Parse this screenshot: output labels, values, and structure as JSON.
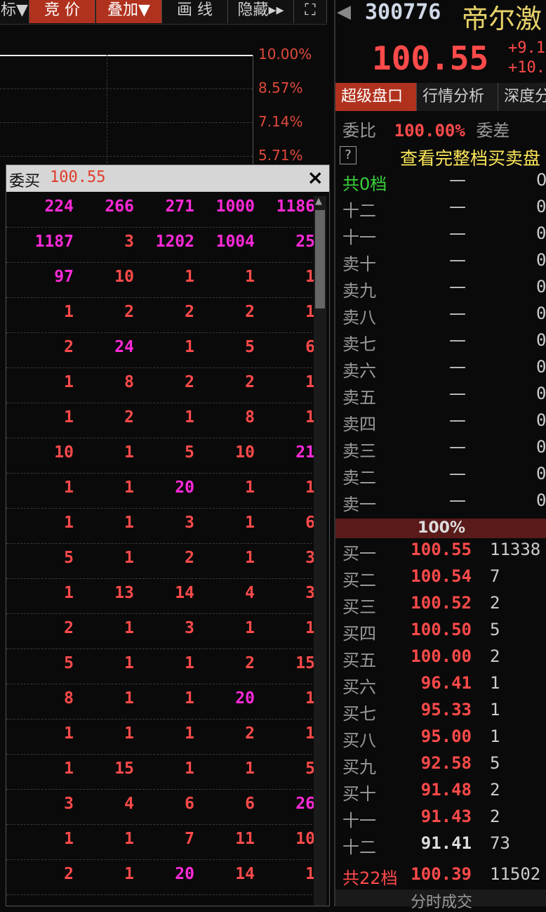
{
  "toolbar": {
    "items": [
      "标▼",
      "竞 价",
      "叠加▼",
      "画 线",
      "隐藏▸▸",
      "⛶"
    ]
  },
  "chart": {
    "pct_labels": [
      "10.00%",
      "8.57%",
      "7.14%",
      "5.71%"
    ]
  },
  "popup": {
    "title": "委买",
    "price": "100.55",
    "close": "×",
    "rows": [
      [
        [
          "224",
          "m"
        ],
        [
          "266",
          "m"
        ],
        [
          "271",
          "m"
        ],
        [
          "1000",
          "m"
        ],
        [
          "1186",
          "m"
        ]
      ],
      [
        [
          "1187",
          "m"
        ],
        [
          "3",
          "r"
        ],
        [
          "1202",
          "m"
        ],
        [
          "1004",
          "m"
        ],
        [
          "25",
          "m"
        ]
      ],
      [
        [
          "97",
          "m"
        ],
        [
          "10",
          "r"
        ],
        [
          "1",
          "r"
        ],
        [
          "1",
          "r"
        ],
        [
          "1",
          "r"
        ]
      ],
      [
        [
          "1",
          "r"
        ],
        [
          "2",
          "r"
        ],
        [
          "2",
          "r"
        ],
        [
          "2",
          "r"
        ],
        [
          "1",
          "r"
        ]
      ],
      [
        [
          "2",
          "r"
        ],
        [
          "24",
          "m"
        ],
        [
          "1",
          "r"
        ],
        [
          "5",
          "r"
        ],
        [
          "6",
          "r"
        ]
      ],
      [
        [
          "1",
          "r"
        ],
        [
          "8",
          "r"
        ],
        [
          "2",
          "r"
        ],
        [
          "2",
          "r"
        ],
        [
          "1",
          "r"
        ]
      ],
      [
        [
          "1",
          "r"
        ],
        [
          "2",
          "r"
        ],
        [
          "1",
          "r"
        ],
        [
          "8",
          "r"
        ],
        [
          "1",
          "r"
        ]
      ],
      [
        [
          "10",
          "r"
        ],
        [
          "1",
          "r"
        ],
        [
          "5",
          "r"
        ],
        [
          "10",
          "r"
        ],
        [
          "21",
          "m"
        ]
      ],
      [
        [
          "1",
          "r"
        ],
        [
          "1",
          "r"
        ],
        [
          "20",
          "m"
        ],
        [
          "1",
          "r"
        ],
        [
          "1",
          "r"
        ]
      ],
      [
        [
          "1",
          "r"
        ],
        [
          "1",
          "r"
        ],
        [
          "3",
          "r"
        ],
        [
          "1",
          "r"
        ],
        [
          "6",
          "r"
        ]
      ],
      [
        [
          "5",
          "r"
        ],
        [
          "1",
          "r"
        ],
        [
          "2",
          "r"
        ],
        [
          "1",
          "r"
        ],
        [
          "3",
          "r"
        ]
      ],
      [
        [
          "1",
          "r"
        ],
        [
          "13",
          "r"
        ],
        [
          "14",
          "r"
        ],
        [
          "4",
          "r"
        ],
        [
          "3",
          "r"
        ]
      ],
      [
        [
          "2",
          "r"
        ],
        [
          "1",
          "r"
        ],
        [
          "3",
          "r"
        ],
        [
          "1",
          "r"
        ],
        [
          "1",
          "r"
        ]
      ],
      [
        [
          "5",
          "r"
        ],
        [
          "1",
          "r"
        ],
        [
          "1",
          "r"
        ],
        [
          "2",
          "r"
        ],
        [
          "15",
          "r"
        ]
      ],
      [
        [
          "8",
          "r"
        ],
        [
          "1",
          "r"
        ],
        [
          "1",
          "r"
        ],
        [
          "20",
          "m"
        ],
        [
          "1",
          "r"
        ]
      ],
      [
        [
          "1",
          "r"
        ],
        [
          "1",
          "r"
        ],
        [
          "1",
          "r"
        ],
        [
          "2",
          "r"
        ],
        [
          "1",
          "r"
        ]
      ],
      [
        [
          "1",
          "r"
        ],
        [
          "15",
          "r"
        ],
        [
          "1",
          "r"
        ],
        [
          "1",
          "r"
        ],
        [
          "5",
          "r"
        ]
      ],
      [
        [
          "3",
          "r"
        ],
        [
          "4",
          "r"
        ],
        [
          "6",
          "r"
        ],
        [
          "6",
          "r"
        ],
        [
          "26",
          "m"
        ]
      ],
      [
        [
          "1",
          "r"
        ],
        [
          "1",
          "r"
        ],
        [
          "7",
          "r"
        ],
        [
          "11",
          "r"
        ],
        [
          "10",
          "r"
        ]
      ],
      [
        [
          "2",
          "r"
        ],
        [
          "1",
          "r"
        ],
        [
          "20",
          "m"
        ],
        [
          "14",
          "r"
        ],
        [
          "1",
          "r"
        ]
      ]
    ]
  },
  "quote": {
    "code": "300776",
    "name": "帝尔激",
    "last_price": "100.55",
    "change1": "+9.1",
    "change2": "+10.",
    "tabs": [
      "超级盘口",
      "行情分析",
      "深度分"
    ],
    "ratio_label": "委比",
    "ratio_value": "100.00%",
    "diff_label": "委差",
    "help": "?",
    "full_depth_link": "查看完整档买卖盘",
    "ask_total_label": "共0档",
    "asks": [
      {
        "label": "十二",
        "price": "—",
        "vol": "0"
      },
      {
        "label": "十一",
        "price": "—",
        "vol": "0"
      },
      {
        "label": "卖十",
        "price": "—",
        "vol": "0"
      },
      {
        "label": "卖九",
        "price": "—",
        "vol": "0"
      },
      {
        "label": "卖八",
        "price": "—",
        "vol": "0"
      },
      {
        "label": "卖七",
        "price": "—",
        "vol": "0"
      },
      {
        "label": "卖六",
        "price": "—",
        "vol": "0"
      },
      {
        "label": "卖五",
        "price": "—",
        "vol": "0"
      },
      {
        "label": "卖四",
        "price": "—",
        "vol": "0"
      },
      {
        "label": "卖三",
        "price": "—",
        "vol": "0"
      },
      {
        "label": "卖二",
        "price": "—",
        "vol": "0"
      },
      {
        "label": "卖一",
        "price": "—",
        "vol": "0"
      }
    ],
    "mid_pct": "100%",
    "bids": [
      {
        "label": "买一",
        "price": "100.55",
        "vol": "11338"
      },
      {
        "label": "买二",
        "price": "100.54",
        "vol": "7"
      },
      {
        "label": "买三",
        "price": "100.52",
        "vol": "2"
      },
      {
        "label": "买四",
        "price": "100.50",
        "vol": "5"
      },
      {
        "label": "买五",
        "price": "100.00",
        "vol": "2"
      },
      {
        "label": "买六",
        "price": "96.41",
        "vol": "1"
      },
      {
        "label": "买七",
        "price": "95.33",
        "vol": "1"
      },
      {
        "label": "买八",
        "price": "95.00",
        "vol": "1"
      },
      {
        "label": "买九",
        "price": "92.58",
        "vol": "5"
      },
      {
        "label": "买十",
        "price": "91.48",
        "vol": "2"
      },
      {
        "label": "十一",
        "price": "91.43",
        "vol": "2"
      },
      {
        "label": "十二",
        "price": "91.41",
        "vol": "73"
      }
    ],
    "bid_total_label": "共22档",
    "bid_total_price": "100.39",
    "bid_total_vol": "11502",
    "bottom_tab": "分时成交"
  }
}
